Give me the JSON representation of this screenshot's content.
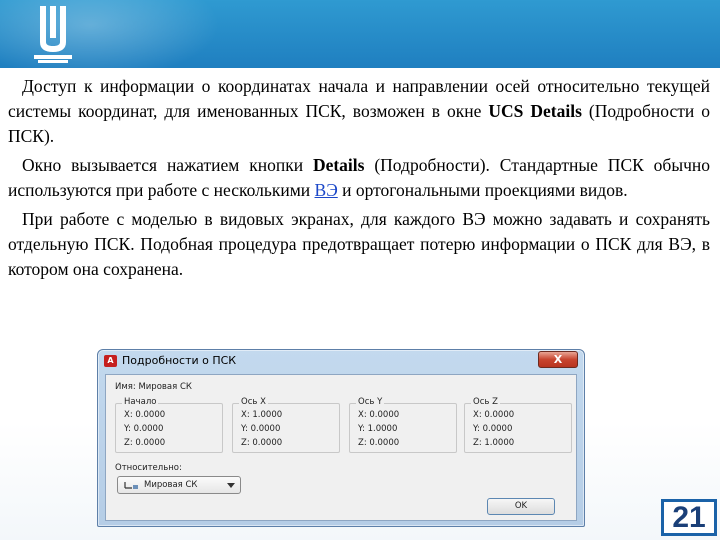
{
  "slide": {
    "paragraph1": {
      "text_before": "Доступ к информации о координатах начала и направлении осей относительно текущей системы координат, для именованных ПСК, возможен в окне ",
      "bold": "UCS Details",
      "text_after": " (Подробности о ПСК)."
    },
    "paragraph2": {
      "text_before": "Окно вызывается нажатием кнопки ",
      "bold": "Details",
      "text_middle": " (Подробности). Стандартные ПСК обычно используются при работе с несколькими ",
      "link": "ВЭ",
      "text_after": " и ортогональными проекциями видов."
    },
    "paragraph3": "При работе с моделью в видовых экранах, для каждого ВЭ можно задавать и сохранять отдельную ПСК. Подобная процедура предотвращает потерю информации о ПСК для ВЭ, в котором она сохранена.",
    "page_number": "21"
  },
  "dialog": {
    "title": "Подробности о ПСК",
    "close_label": "X",
    "name_label": "Имя:",
    "name_value": "Мировая СК",
    "groups": [
      {
        "label": "Начало",
        "lines": [
          "X: 0.0000",
          "Y: 0.0000",
          "Z: 0.0000"
        ]
      },
      {
        "label": "Ось X",
        "lines": [
          "X: 1.0000",
          "Y: 0.0000",
          "Z: 0.0000"
        ]
      },
      {
        "label": "Ось Y",
        "lines": [
          "X: 0.0000",
          "Y: 1.0000",
          "Z: 0.0000"
        ]
      },
      {
        "label": "Ось Z",
        "lines": [
          "X: 0.0000",
          "Y: 0.0000",
          "Z: 1.0000"
        ]
      }
    ],
    "relative_label": "Относительно:",
    "relative_value": "Мировая СК",
    "ok_label": "OK"
  },
  "colors": {
    "header": "#2f9ad1",
    "link": "#1b47c8",
    "page_number_border": "#1a62a8"
  },
  "icons": [
    "university-logo-icon",
    "app-icon",
    "close-icon",
    "ucs-icon",
    "chevron-down-icon"
  ]
}
